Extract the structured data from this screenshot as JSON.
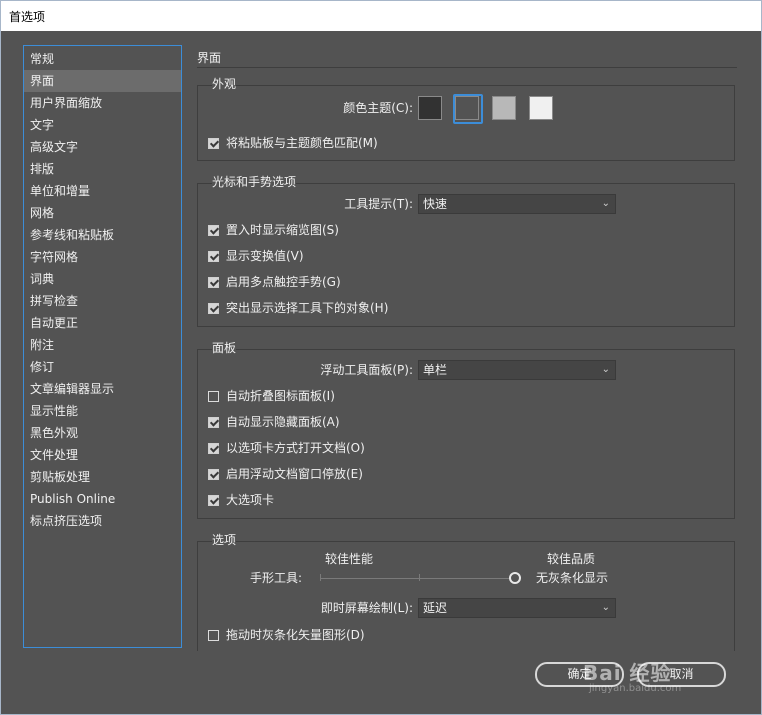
{
  "window": {
    "title": "首选项",
    "close_glyph": "✕"
  },
  "sidebar": {
    "items": [
      {
        "label": "常规"
      },
      {
        "label": "界面",
        "selected": true
      },
      {
        "label": "用户界面缩放"
      },
      {
        "label": "文字"
      },
      {
        "label": "高级文字"
      },
      {
        "label": "排版"
      },
      {
        "label": "单位和增量"
      },
      {
        "label": "网格"
      },
      {
        "label": "参考线和粘贴板"
      },
      {
        "label": "字符网格"
      },
      {
        "label": "词典"
      },
      {
        "label": "拼写检查"
      },
      {
        "label": "自动更正"
      },
      {
        "label": "附注"
      },
      {
        "label": "修订"
      },
      {
        "label": "文章编辑器显示"
      },
      {
        "label": "显示性能"
      },
      {
        "label": "黑色外观"
      },
      {
        "label": "文件处理"
      },
      {
        "label": "剪贴板处理"
      },
      {
        "label": "Publish Online"
      },
      {
        "label": "标点挤压选项"
      }
    ]
  },
  "page": {
    "title": "界面"
  },
  "appearance": {
    "label": "外观",
    "color_theme_label": "颜色主题(C):",
    "swatches": [
      {
        "name": "darkest",
        "color": "#323232",
        "selected": false
      },
      {
        "name": "dark",
        "color": "#535353",
        "selected": true
      },
      {
        "name": "light",
        "color": "#b8b8b8",
        "selected": false
      },
      {
        "name": "lightest",
        "color": "#f0f0f0",
        "selected": false
      }
    ],
    "match_pasteboard_label": "将粘贴板与主题颜色匹配(M)",
    "match_pasteboard_checked": true
  },
  "cursor": {
    "label": "光标和手势选项",
    "tooltip_label": "工具提示(T):",
    "tooltip_value": "快速",
    "options": [
      {
        "label": "置入时显示缩览图(S)",
        "checked": true
      },
      {
        "label": "显示变换值(V)",
        "checked": true
      },
      {
        "label": "启用多点触控手势(G)",
        "checked": true
      },
      {
        "label": "突出显示选择工具下的对象(H)",
        "checked": true
      }
    ]
  },
  "panels": {
    "label": "面板",
    "floating_label": "浮动工具面板(P):",
    "floating_value": "单栏",
    "options": [
      {
        "label": "自动折叠图标面板(I)",
        "checked": false
      },
      {
        "label": "自动显示隐藏面板(A)",
        "checked": true
      },
      {
        "label": "以选项卡方式打开文档(O)",
        "checked": true
      },
      {
        "label": "启用浮动文档窗口停放(E)",
        "checked": true
      },
      {
        "label": "大选项卡",
        "checked": true
      }
    ]
  },
  "options": {
    "label": "选项",
    "better_perf": "较佳性能",
    "better_quality": "较佳品质",
    "hand_tool_label": "手形工具:",
    "hand_tool_value_label": "无灰条化显示",
    "hand_tool_level": 1.0,
    "live_draw_label": "即时屏幕绘制(L):",
    "live_draw_value": "延迟",
    "greek_vector_label": "拖动时灰条化矢量图形(D)",
    "greek_vector_checked": false
  },
  "footer": {
    "ok_label": "确定",
    "cancel_label": "取消"
  },
  "watermark": {
    "text": "Bai 经验",
    "sub": "jingyan.baidu.com"
  }
}
